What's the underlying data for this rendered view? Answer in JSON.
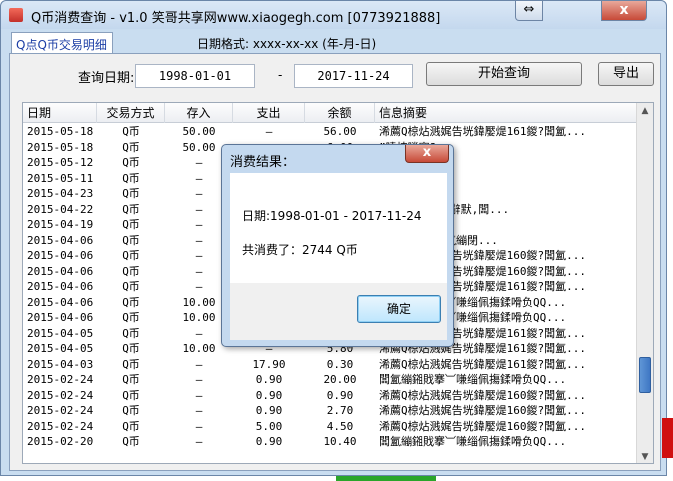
{
  "window": {
    "title": "Q币消费查询 - v1.0 笑哥共享网www.xiaogegh.com [0773921888]",
    "swap_icon": "⇔",
    "close_icon": "x"
  },
  "tab": {
    "label": "Q点Q币交易明细"
  },
  "date_format": "日期格式: xxxx-xx-xx (年-月-日)",
  "query": {
    "label": "查询日期:",
    "start_date": "1998-01-01",
    "dash": "-",
    "end_date": "2017-11-24",
    "start_button": "开始查询",
    "export_button": "导出"
  },
  "table": {
    "headers": [
      "日期",
      "交易方式",
      "存入",
      "支出",
      "余额",
      "信息摘要"
    ],
    "rows": [
      [
        "2015-05-18",
        "Q币",
        "50.00",
        "—",
        "56.00",
        "浠薦Q椋炶溅娓告垙鍏嬮煶161鍐?闆氳..."
      ],
      [
        "2015-05-18",
        "Q币",
        "50.00",
        "—",
        "6.00",
        "”曉楝瞠窗?,"
      ],
      [
        "2015-05-12",
        "Q币",
        "—",
        "",
        "",
        "”曉楝瞠窗?,"
      ],
      [
        "2015-05-11",
        "Q币",
        "—",
        "",
        "",
        "”曉楝瞠窗?,"
      ],
      [
        "2015-04-23",
        "Q币",
        "—",
        "",
        "",
        "”曉楝瞠窗?,"
      ],
      [
        "2015-04-22",
        "Q币",
        "—",
        "",
        "",
        "?android)寥辭默,闆..."
      ],
      [
        "2015-04-19",
        "Q币",
        "—",
        "",
        "",
        "”曉楝瞠窗?,"
      ],
      [
        "2015-04-06",
        "Q币",
        "—",
        "",
        "",
        "濂绣绔樹紅闆氳繃閉..."
      ],
      [
        "2015-04-06",
        "Q币",
        "—",
        "",
        "",
        "浠薦Q椋炶溅娓告垙鍏嬮煶160鍐?闆氳..."
      ],
      [
        "2015-04-06",
        "Q币",
        "—",
        "",
        "",
        "浠薦Q椋炶溅娓告垙鍏嬮煶160鍐?闆氳..."
      ],
      [
        "2015-04-06",
        "Q币",
        "—",
        "",
        "",
        "浠薦Q椋炶溅娓告垙鍏嬮煶161鍐?闆氳..."
      ],
      [
        "2015-04-06",
        "Q币",
        "10.00",
        "",
        "",
        "闆氳繃鎺戝搴︺嗛缁佩摥鍒嗗负QQ..."
      ],
      [
        "2015-04-06",
        "Q币",
        "10.00",
        "",
        "",
        "闆氳繃鎺戝搴︺嗛缁佩摥鍒嗗负QQ..."
      ],
      [
        "2015-04-05",
        "Q币",
        "—",
        "",
        "",
        "浠薦Q椋炶溅娓告垙鍏嬮煶161鍐?闆氳..."
      ],
      [
        "2015-04-05",
        "Q币",
        "10.00",
        "—",
        "5.80",
        "浠薦Q椋炶溅娓告垙鍏嬮煶161鍐?闆氳..."
      ],
      [
        "2015-04-03",
        "Q币",
        "—",
        "17.90",
        "0.30",
        "浠薦Q椋炶溅娓告垙鍏嬮煶161鍐?闆氳..."
      ],
      [
        "2015-02-24",
        "Q币",
        "—",
        "0.90",
        "20.00",
        "闆氳繃鎺戝搴︺嗛缁佩摥鍒嗗负QQ..."
      ],
      [
        "2015-02-24",
        "Q币",
        "—",
        "0.90",
        "0.90",
        "浠薦Q椋炶溅娓告垙鍏嬮煶160鍐?闆氳..."
      ],
      [
        "2015-02-24",
        "Q币",
        "—",
        "0.90",
        "2.70",
        "浠薦Q椋炶溅娓告垙鍏嬮煶160鍐?闆氳..."
      ],
      [
        "2015-02-24",
        "Q币",
        "—",
        "5.00",
        "4.50",
        "浠薦Q椋炶溅娓告垙鍏嬮煶160鍐?闆氳..."
      ],
      [
        "2015-02-20",
        "Q币",
        "—",
        "0.90",
        "10.40",
        "闆氳繃鎺戝搴︺嗛缁佩摥鍒嗗负QQ..."
      ]
    ]
  },
  "scrollbar": {
    "up": "▲",
    "down": "▼"
  },
  "dialog": {
    "title": "消费结果：",
    "close_icon": "x",
    "line1": "日期:1998-01-01 - 2017-11-24",
    "line2": "共消费了：2744 Q币",
    "ok_button": "确定"
  }
}
